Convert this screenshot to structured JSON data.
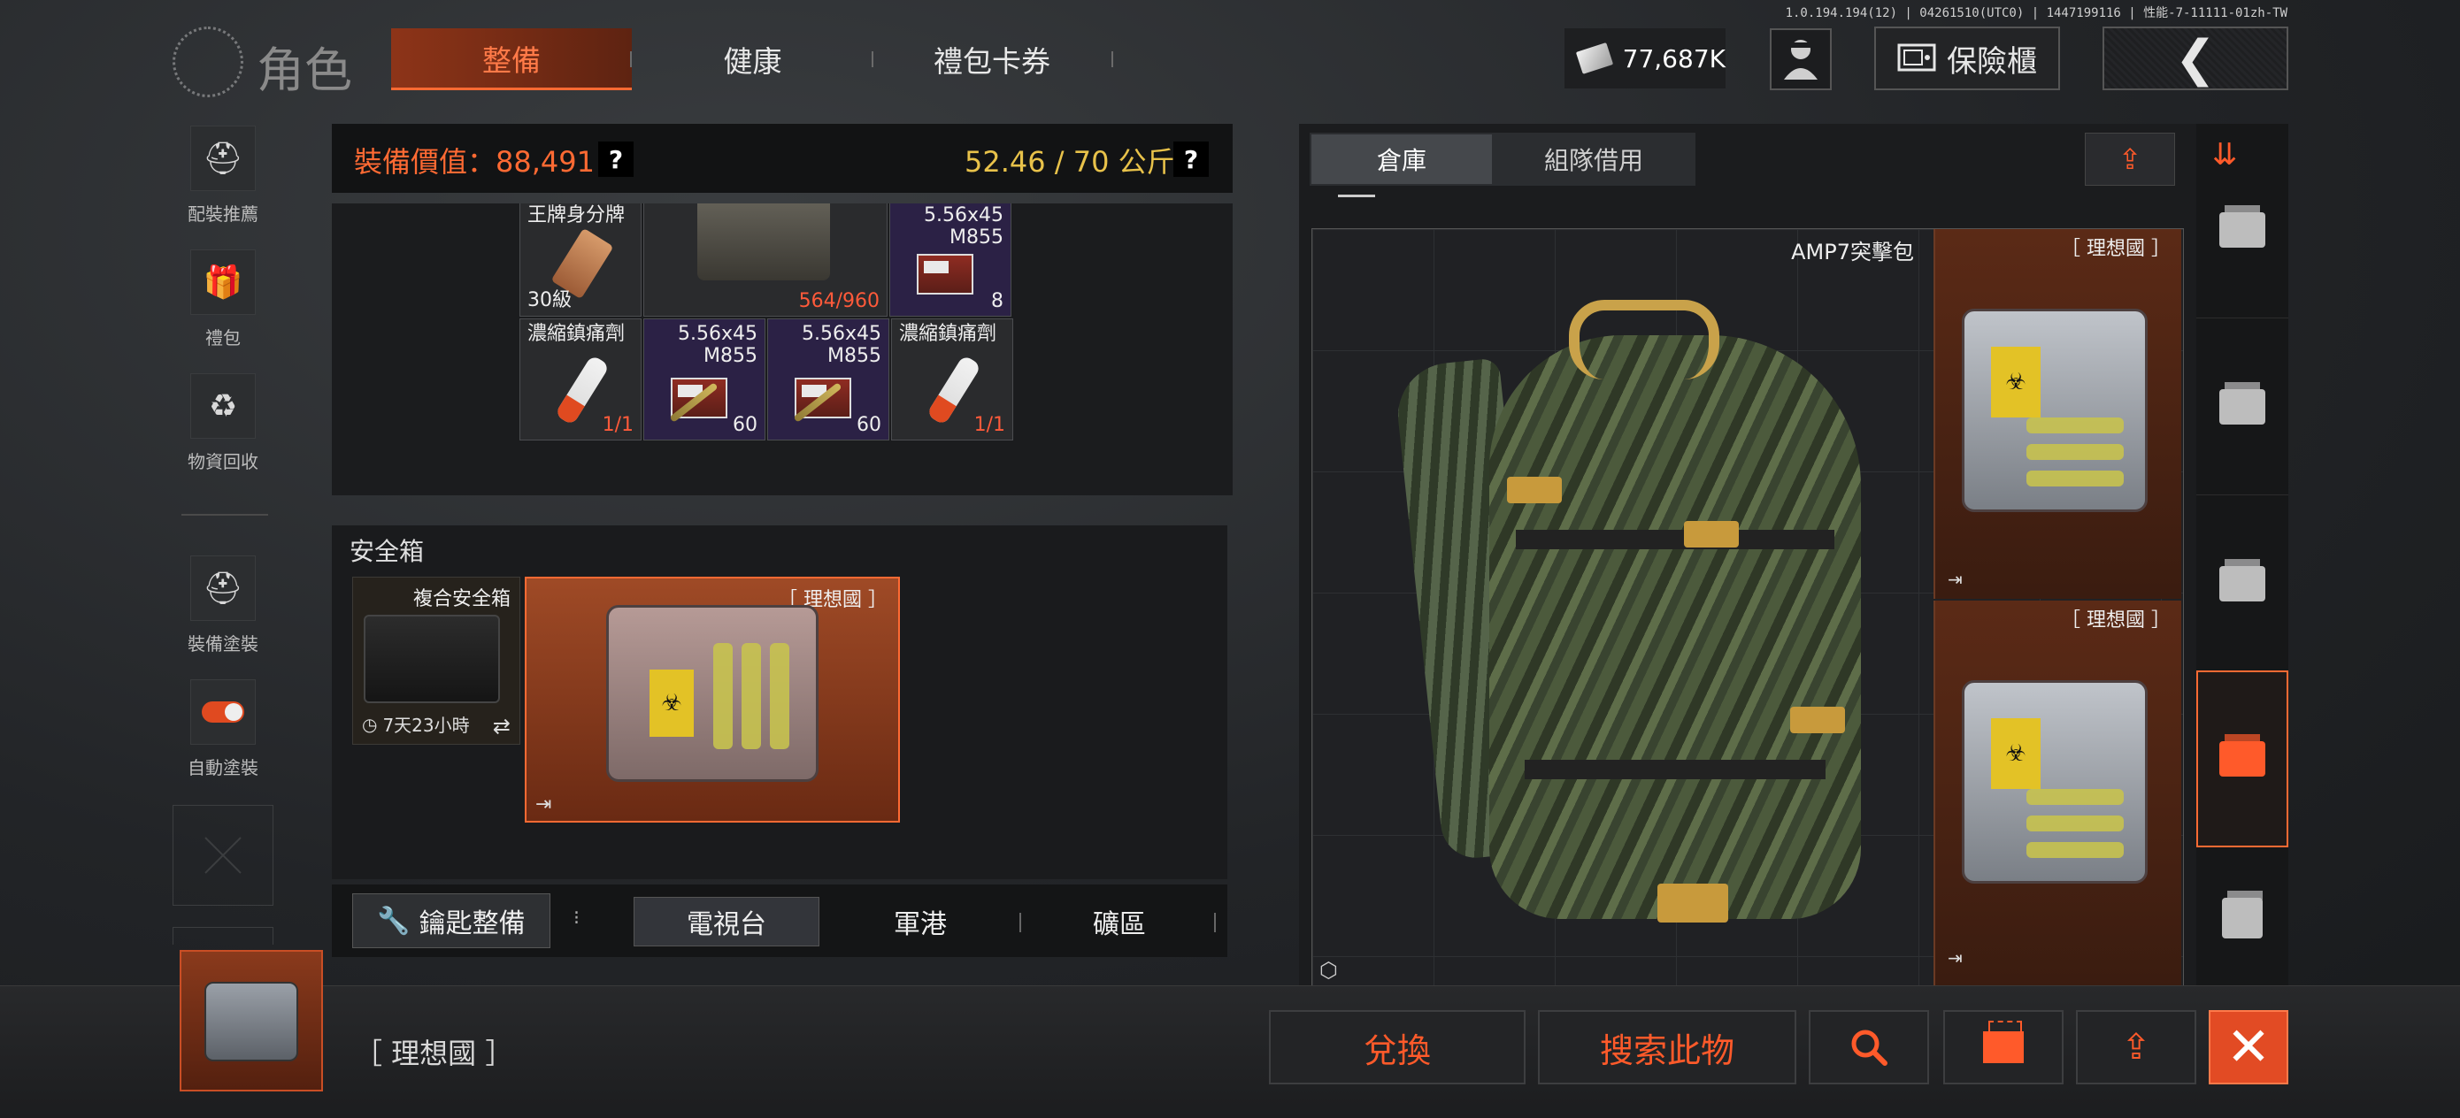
{
  "version_info": "1.0.194.194(12) | 04261510(UTC0) | 1447199116 | 性能-7-11111-01zh-TW",
  "header": {
    "title": "角色",
    "tabs": [
      {
        "label": "整備",
        "active": true
      },
      {
        "label": "健康",
        "active": false
      },
      {
        "label": "禮包卡券",
        "active": false
      }
    ],
    "currency": "77,687K",
    "insurance_label": "保險櫃",
    "back_icon": "chevron-left-icon"
  },
  "sidebar": {
    "items": [
      {
        "label": "配裝推薦",
        "icon": "loadout-icon"
      },
      {
        "label": "禮包",
        "icon": "gift-icon"
      },
      {
        "label": "物資回收",
        "icon": "recycle-icon"
      },
      {
        "label": "裝備塗裝",
        "icon": "helmet-icon"
      },
      {
        "label": "自動塗裝",
        "icon": "toggle-icon"
      }
    ]
  },
  "equipment": {
    "value_label": "裝備價值：88,491",
    "weight_label": "52.46 / 70 公斤",
    "help": "?",
    "items": [
      {
        "name": "王牌身分牌",
        "count": "30級"
      },
      {
        "name": "",
        "count": "564/960"
      },
      {
        "name": "5.56x45\nM855",
        "count": "8"
      },
      {
        "name": "濃縮鎮痛劑",
        "count": "1/1"
      },
      {
        "name": "5.56x45\nM855",
        "count": "60"
      },
      {
        "name": "5.56x45\nM855",
        "count": "60"
      },
      {
        "name": "濃縮鎮痛劑",
        "count": "1/1"
      }
    ]
  },
  "safe_box": {
    "title": "安全箱",
    "item1": {
      "name": "複合安全箱",
      "timer": "7天23小時",
      "swap": "⇄"
    },
    "item2": {
      "name": "［ 理想國 ］"
    }
  },
  "key_bar": {
    "key_label": "鑰匙整備",
    "dots": "⁝",
    "maps": [
      {
        "label": "電視台",
        "active": true
      },
      {
        "label": "軍港",
        "active": false
      },
      {
        "label": "礦區",
        "active": false
      }
    ]
  },
  "storage": {
    "tabs": [
      {
        "label": "倉庫",
        "active": true
      },
      {
        "label": "組隊借用",
        "active": false
      }
    ],
    "backpack_name": "AMP7突擊包",
    "case_cells": [
      {
        "name": "［ 理想國 ］"
      },
      {
        "name": "［ 理想國 ］"
      }
    ]
  },
  "bottom": {
    "selected_name": "［ 理想國 ］",
    "exchange_label": "兌換",
    "search_item_label": "搜索此物",
    "search_icon": "search-icon",
    "close_icon": "close-icon"
  },
  "colors": {
    "accent": "#ff6a33",
    "gold": "#e8c24a",
    "panel": "#1b1c1e"
  }
}
